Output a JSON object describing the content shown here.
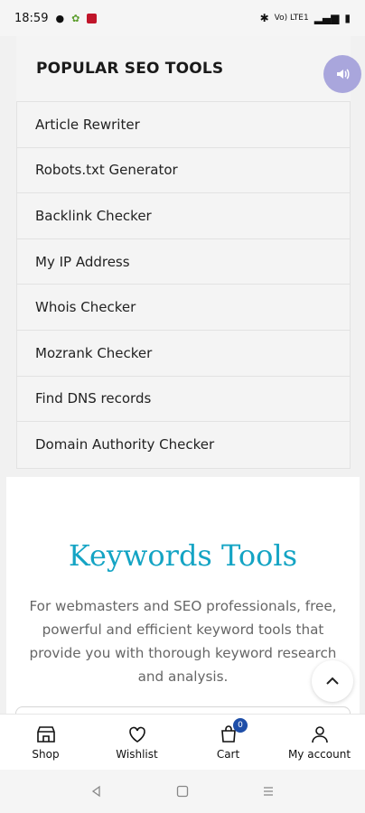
{
  "status_bar": {
    "time": "18:59",
    "right_text": "Vo) LTE1"
  },
  "popular_tools": {
    "title": "POPULAR SEO TOOLS",
    "items": [
      {
        "label": "Article Rewriter"
      },
      {
        "label": "Robots.txt Generator"
      },
      {
        "label": "Backlink Checker"
      },
      {
        "label": "My IP Address"
      },
      {
        "label": "Whois Checker"
      },
      {
        "label": "Mozrank Checker"
      },
      {
        "label": "Find DNS records"
      },
      {
        "label": "Domain Authority Checker"
      }
    ]
  },
  "keywords": {
    "title": "Keywords Tools",
    "description": "For webmasters and SEO professionals, free, powerful and efficient keyword tools that provide you with thorough keyword research and analysis."
  },
  "bottom_nav": {
    "shop": "Shop",
    "wishlist": "Wishlist",
    "cart": "Cart",
    "cart_count": "0",
    "account": "My account"
  },
  "colors": {
    "accent": "#14a4c4",
    "badge": "#1e4ea8",
    "voice": "#a9a6dc"
  }
}
